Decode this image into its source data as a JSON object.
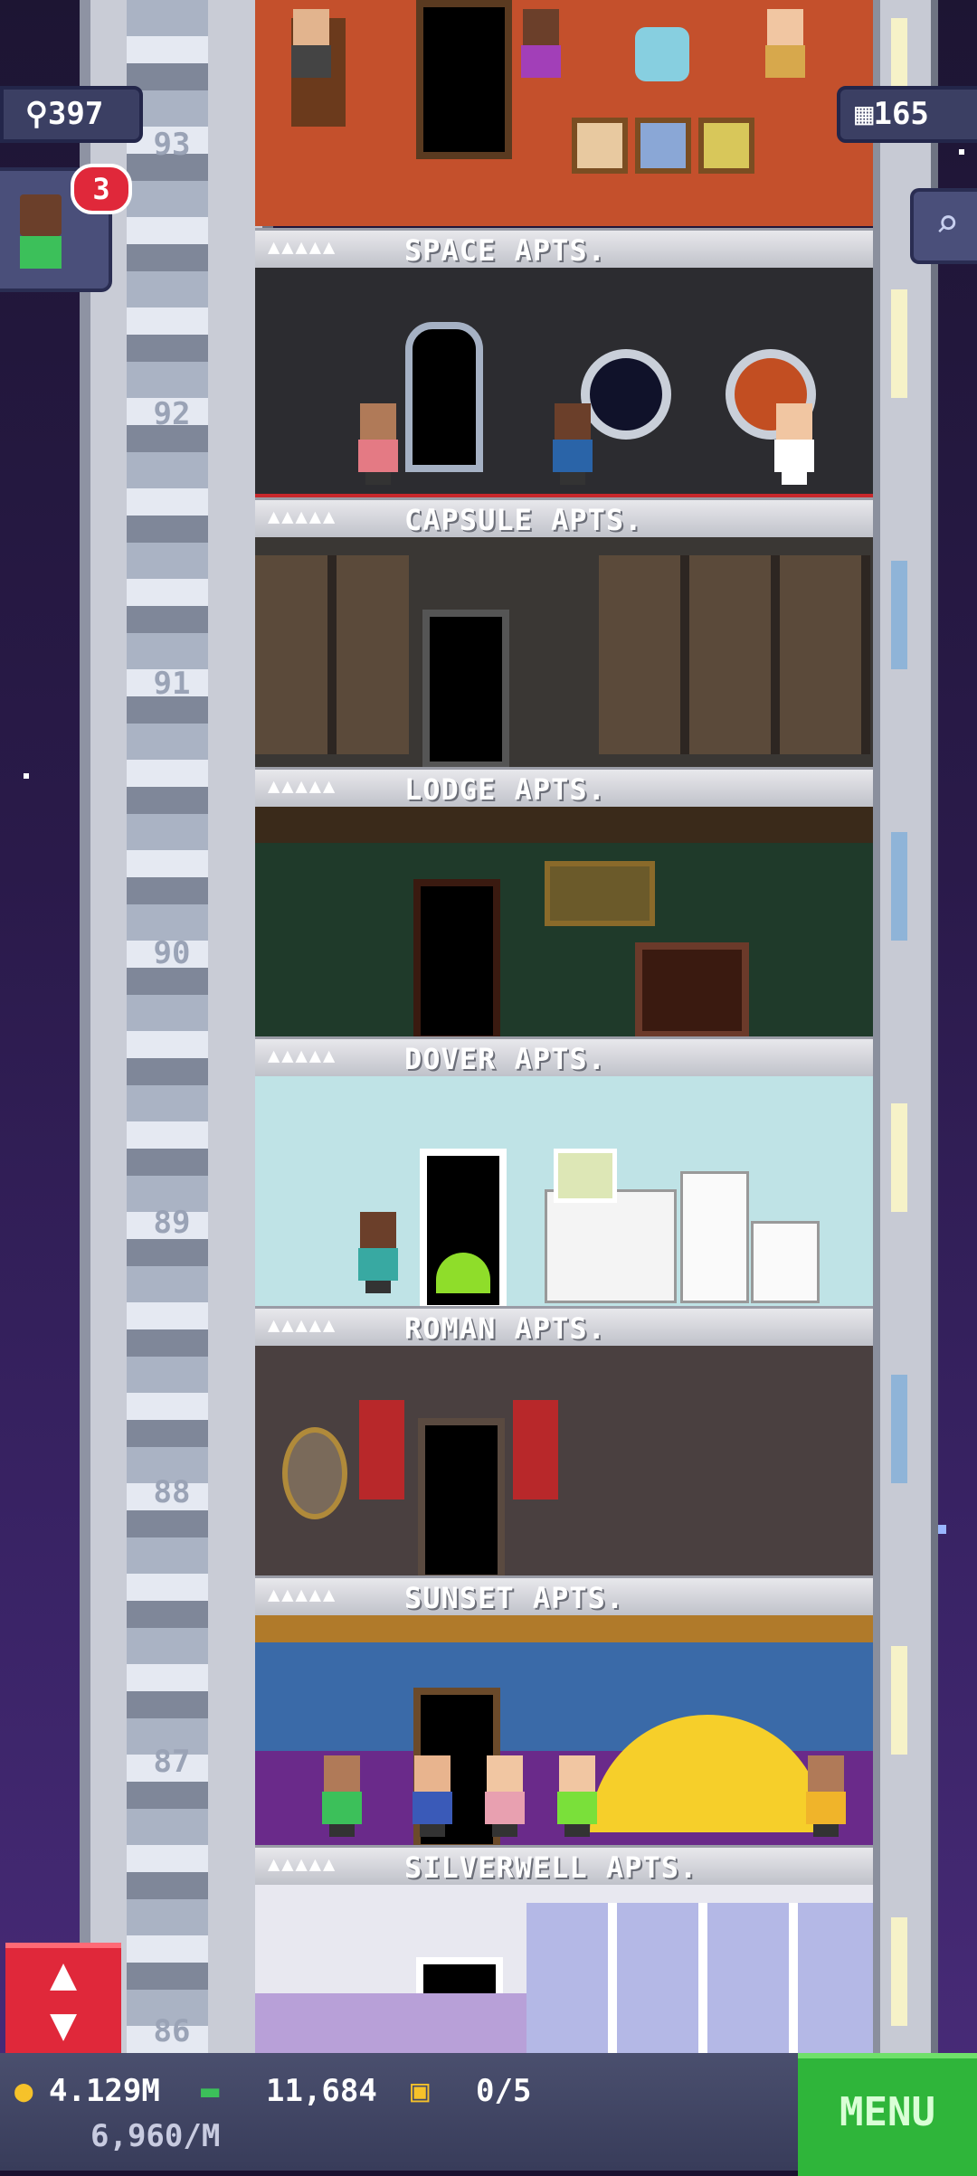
{
  "hud": {
    "population": "397",
    "floors": "165",
    "notification_count": "3",
    "coins": "4.129M",
    "tower_bux": "11,684",
    "vip_tickets": "0/5",
    "income_rate": "6,960/M",
    "menu_label": "MENU"
  },
  "elevator_numbers": [
    "93",
    "92",
    "91",
    "90",
    "89",
    "88",
    "87",
    "86"
  ],
  "floors": [
    {
      "name": "SPACE APTS.",
      "pips": "▲▲▲▲▲"
    },
    {
      "name": "CAPSULE APTS.",
      "pips": "▲▲▲▲▲"
    },
    {
      "name": "LODGE APTS.",
      "pips": "▲▲▲▲▲"
    },
    {
      "name": "DOVER APTS.",
      "pips": "▲▲▲▲▲"
    },
    {
      "name": "ROMAN APTS.",
      "pips": "▲▲▲▲▲"
    },
    {
      "name": "SUNSET APTS.",
      "pips": "▲▲▲▲▲"
    },
    {
      "name": "SILVERWELL APTS.",
      "pips": "▲▲▲▲▲"
    }
  ],
  "colors": {
    "menu": "#2fb53a",
    "elevator_button": "#e0283a",
    "badge": "#e0283a"
  },
  "icons": [
    "person-icon",
    "floors-icon",
    "search-icon",
    "coin-icon",
    "bux-icon",
    "ticket-icon",
    "elevator-arrows-icon"
  ]
}
